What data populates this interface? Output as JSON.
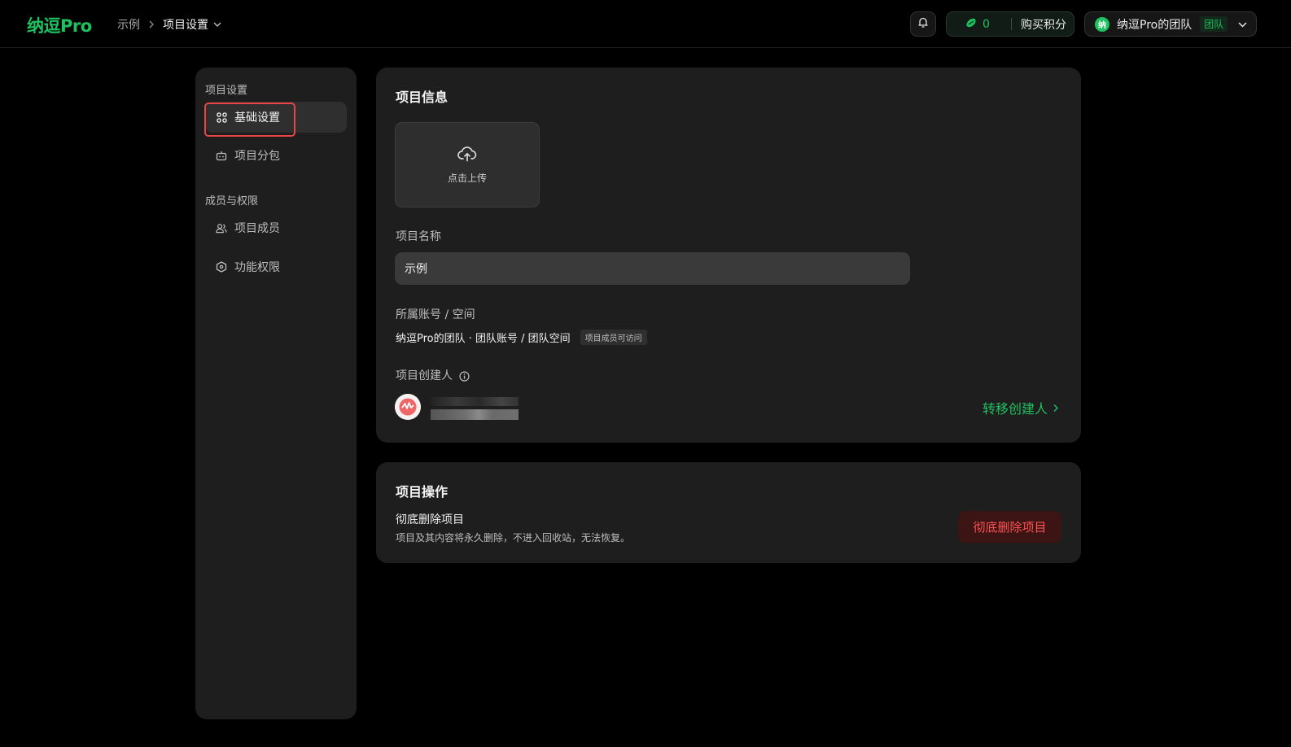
{
  "header": {
    "logo": "纳逗Pro",
    "breadcrumb": {
      "parent": "示例",
      "current": "项目设置"
    },
    "points": {
      "count": "0",
      "buy_label": "购买积分"
    },
    "team": {
      "avatar_char": "纳",
      "name": "纳逗Pro的团队",
      "tag": "团队"
    }
  },
  "sidebar": {
    "groups": [
      {
        "label": "项目设置",
        "items": [
          {
            "label": "基础设置",
            "icon": "grid-icon",
            "active": true
          },
          {
            "label": "项目分包",
            "icon": "robot-icon"
          }
        ]
      },
      {
        "label": "成员与权限",
        "items": [
          {
            "label": "项目成员",
            "icon": "users-icon"
          },
          {
            "label": "功能权限",
            "icon": "shield-hex-icon"
          }
        ]
      }
    ]
  },
  "project_info": {
    "title": "项目信息",
    "upload_label": "点击上传",
    "name_label": "项目名称",
    "name_value": "示例",
    "account_label": "所属账号 / 空间",
    "account_value": "纳逗Pro的团队 · 团队账号 / 团队空间",
    "access_tag": "项目成员可访问",
    "creator_label": "项目创建人",
    "transfer_label": "转移创建人"
  },
  "project_ops": {
    "title": "项目操作",
    "delete_title": "彻底删除项目",
    "delete_desc": "项目及其内容将永久删除，不进入回收站，无法恢复。",
    "delete_button": "彻底删除项目"
  },
  "colors": {
    "brand": "#1ec15f",
    "danger": "#ff5252",
    "danger_bg": "#3d1414",
    "card_bg": "#1e1e1e"
  }
}
